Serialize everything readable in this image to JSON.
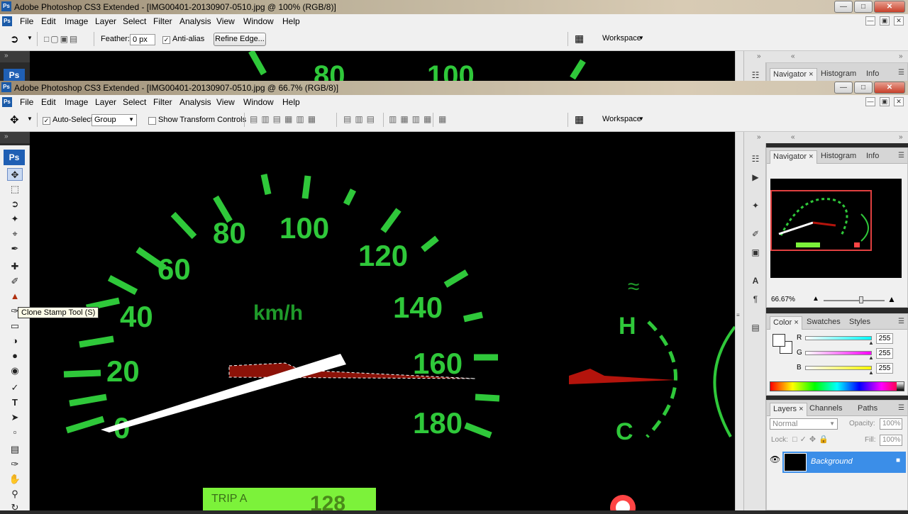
{
  "back_window": {
    "title": "Adobe Photoshop CS3 Extended - [IMG00401-20130907-0510.jpg @ 100% (RGB/8)]",
    "menus": [
      "File",
      "Edit",
      "Image",
      "Layer",
      "Select",
      "Filter",
      "Analysis",
      "View",
      "Window",
      "Help"
    ],
    "options": {
      "feather_label": "Feather:",
      "feather_value": "0 px",
      "antialias_label": "Anti-alias",
      "refine_edge": "Refine Edge...",
      "workspace": "Workspace"
    },
    "panel_tabs": [
      "Navigator",
      "Histogram",
      "Info"
    ]
  },
  "front_window": {
    "title": "Adobe Photoshop CS3 Extended - [IMG00401-20130907-0510.jpg @ 66.7% (RGB/8)]",
    "menus": [
      "File",
      "Edit",
      "Image",
      "Layer",
      "Select",
      "Filter",
      "Analysis",
      "View",
      "Window",
      "Help"
    ],
    "options": {
      "auto_select_label": "Auto-Select:",
      "auto_select_value": "Group",
      "show_transform_label": "Show Transform Controls",
      "workspace": "Workspace"
    }
  },
  "tooltip": "Clone Stamp Tool (S)",
  "toolbox_logo": "Ps",
  "panels": {
    "navigator": {
      "tabs": [
        "Navigator",
        "Histogram",
        "Info"
      ],
      "zoom": "66.67%",
      "zoom_fraction": 0.62
    },
    "color": {
      "tabs": [
        "Color",
        "Swatches",
        "Styles"
      ],
      "channels": [
        {
          "label": "R",
          "value": "255",
          "gradient": "#00ffff"
        },
        {
          "label": "G",
          "value": "255",
          "gradient": "#ff00ff"
        },
        {
          "label": "B",
          "value": "255",
          "gradient": "#ffff00"
        }
      ]
    },
    "layers": {
      "tabs": [
        "Layers",
        "Channels",
        "Paths"
      ],
      "blend_mode": "Normal",
      "opacity_label": "Opacity:",
      "opacity": "100%",
      "lock_label": "Lock:",
      "fill_label": "Fill:",
      "fill": "100%",
      "layer_name": "Background"
    }
  },
  "speedometer": {
    "numbers": [
      "0",
      "20",
      "40",
      "60",
      "80",
      "100",
      "120",
      "140",
      "160",
      "180"
    ],
    "unit": "km/h",
    "temp_high": "H",
    "temp_low": "C",
    "trip_text": "TRIP A",
    "odo_value": "128",
    "back_numbers": [
      "80",
      "100"
    ]
  },
  "colors": {
    "gauge_green": "#2fc83a",
    "needle_red": "#c81a10",
    "layer_select": "#3b8ee8"
  }
}
